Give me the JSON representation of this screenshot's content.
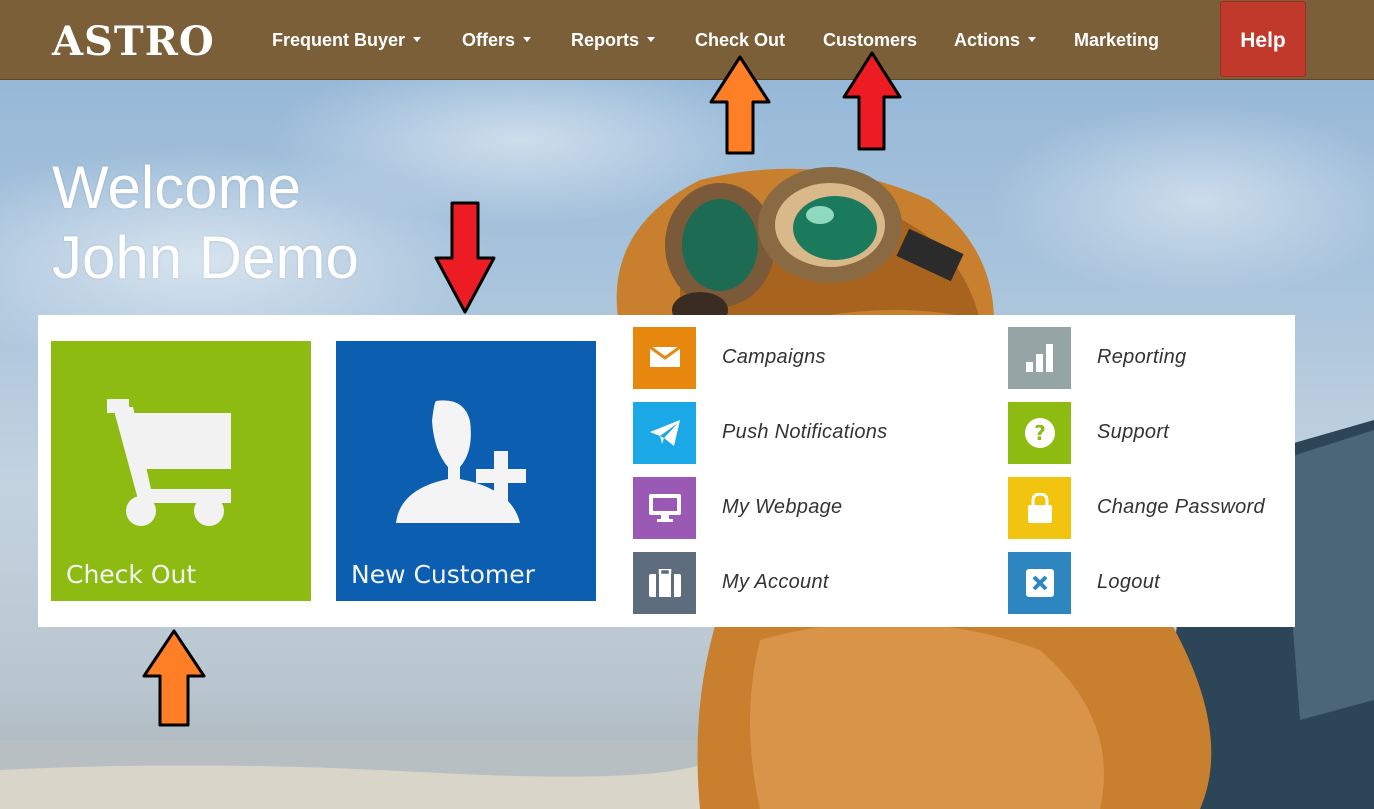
{
  "navbar": {
    "logo": "ASTRO",
    "items": [
      {
        "label": "Frequent Buyer",
        "dropdown": true
      },
      {
        "label": "Offers",
        "dropdown": true
      },
      {
        "label": "Reports",
        "dropdown": true
      },
      {
        "label": "Check Out",
        "dropdown": false
      },
      {
        "label": "Customers",
        "dropdown": false
      },
      {
        "label": "Actions",
        "dropdown": true
      },
      {
        "label": "Marketing",
        "dropdown": false
      }
    ],
    "help_label": "Help"
  },
  "welcome": {
    "line1": "Welcome",
    "line2": "John Demo"
  },
  "tiles": [
    {
      "label": "Check Out",
      "icon": "shopping-cart-icon",
      "color": "#8dbb12"
    },
    {
      "label": "New Customer",
      "icon": "add-user-icon",
      "color": "#0c5fb0"
    }
  ],
  "menu": [
    {
      "label": "Campaigns",
      "icon": "envelope-icon",
      "color": "#e8870e"
    },
    {
      "label": "Push Notifications",
      "icon": "paper-plane-icon",
      "color": "#1aa9e6"
    },
    {
      "label": "My Webpage",
      "icon": "monitor-icon",
      "color": "#9b59b6"
    },
    {
      "label": "My Account",
      "icon": "briefcase-icon",
      "color": "#5d6d7e"
    },
    {
      "label": "Reporting",
      "icon": "bar-chart-icon",
      "color": "#95a5a6"
    },
    {
      "label": "Support",
      "icon": "question-icon",
      "color": "#8dbb12"
    },
    {
      "label": "Change Password",
      "icon": "lock-icon",
      "color": "#f1c40f"
    },
    {
      "label": "Logout",
      "icon": "close-icon",
      "color": "#2e86c1"
    }
  ],
  "colors": {
    "navbar": "#7a5f38",
    "help": "#c0392b",
    "arrow_orange": "#ff7f27",
    "arrow_red": "#ed1c24"
  }
}
